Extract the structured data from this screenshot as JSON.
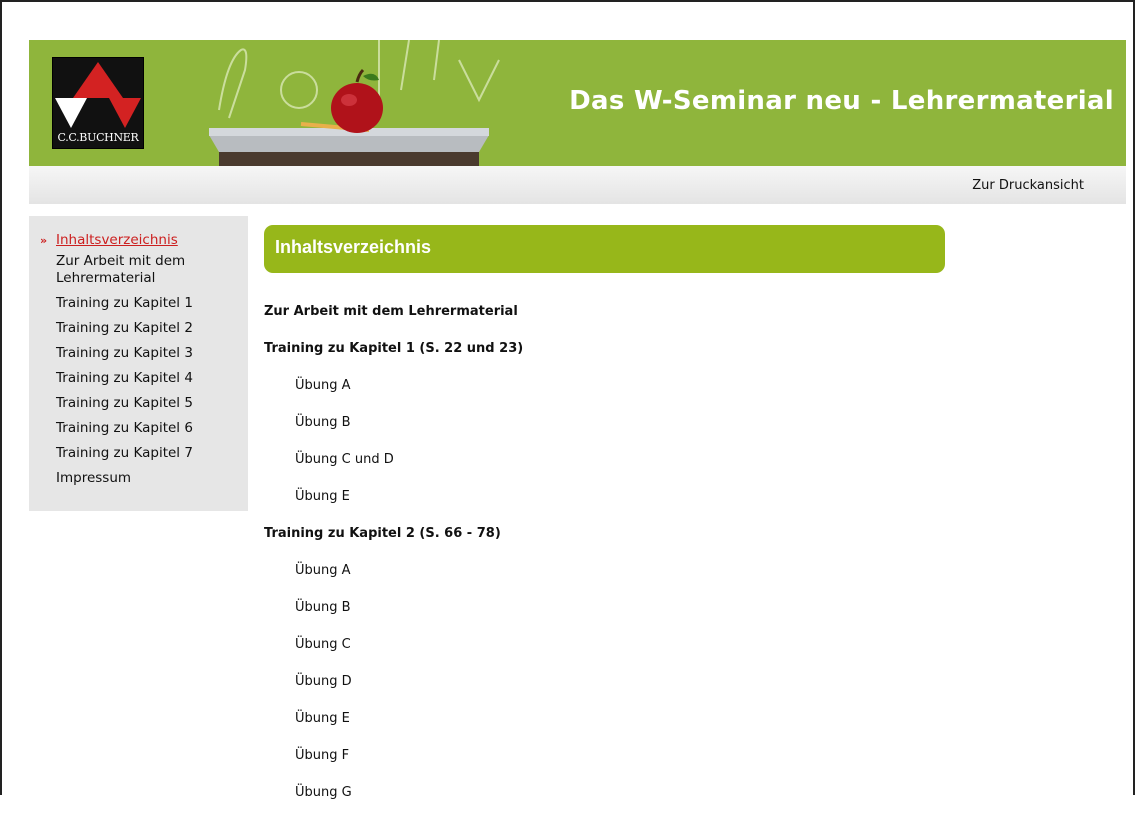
{
  "header": {
    "logo_text": "C.C.BUCHNER",
    "title": "Das W-Seminar neu - Lehrermaterial"
  },
  "toolbar": {
    "print_label": "Zur Druckansicht"
  },
  "sidebar": {
    "items": [
      {
        "label": "Inhaltsverzeichnis",
        "active": true
      },
      {
        "label": "Zur Arbeit mit dem Lehrermaterial"
      },
      {
        "label": "Training zu Kapitel 1"
      },
      {
        "label": "Training zu Kapitel 2"
      },
      {
        "label": "Training zu Kapitel 3"
      },
      {
        "label": "Training zu Kapitel 4"
      },
      {
        "label": "Training zu Kapitel 5"
      },
      {
        "label": "Training zu Kapitel 6"
      },
      {
        "label": "Training zu Kapitel 7"
      },
      {
        "label": "Impressum"
      }
    ]
  },
  "main": {
    "heading": "Inhaltsverzeichnis",
    "toc": [
      {
        "label": "Zur Arbeit mit dem Lehrermaterial",
        "level": 1
      },
      {
        "label": "Training zu Kapitel 1 (S. 22 und 23)",
        "level": 1
      },
      {
        "label": "Übung A",
        "level": 2
      },
      {
        "label": "Übung B",
        "level": 2
      },
      {
        "label": "Übung C und D",
        "level": 2
      },
      {
        "label": "Übung E",
        "level": 2
      },
      {
        "label": "Training zu Kapitel 2 (S. 66 - 78)",
        "level": 1
      },
      {
        "label": "Übung A",
        "level": 2
      },
      {
        "label": "Übung B",
        "level": 2
      },
      {
        "label": "Übung C",
        "level": 2
      },
      {
        "label": "Übung D",
        "level": 2
      },
      {
        "label": "Übung E",
        "level": 2
      },
      {
        "label": "Übung F",
        "level": 2
      },
      {
        "label": "Übung G",
        "level": 2
      }
    ]
  },
  "colors": {
    "banner_green": "#8fb53c",
    "heading_green": "#97b71a",
    "active_link": "#cc1f1f",
    "sidebar_bg": "#e6e6e6"
  },
  "icons": {
    "sidebar_active_marker": "double-chevron-right-icon"
  }
}
